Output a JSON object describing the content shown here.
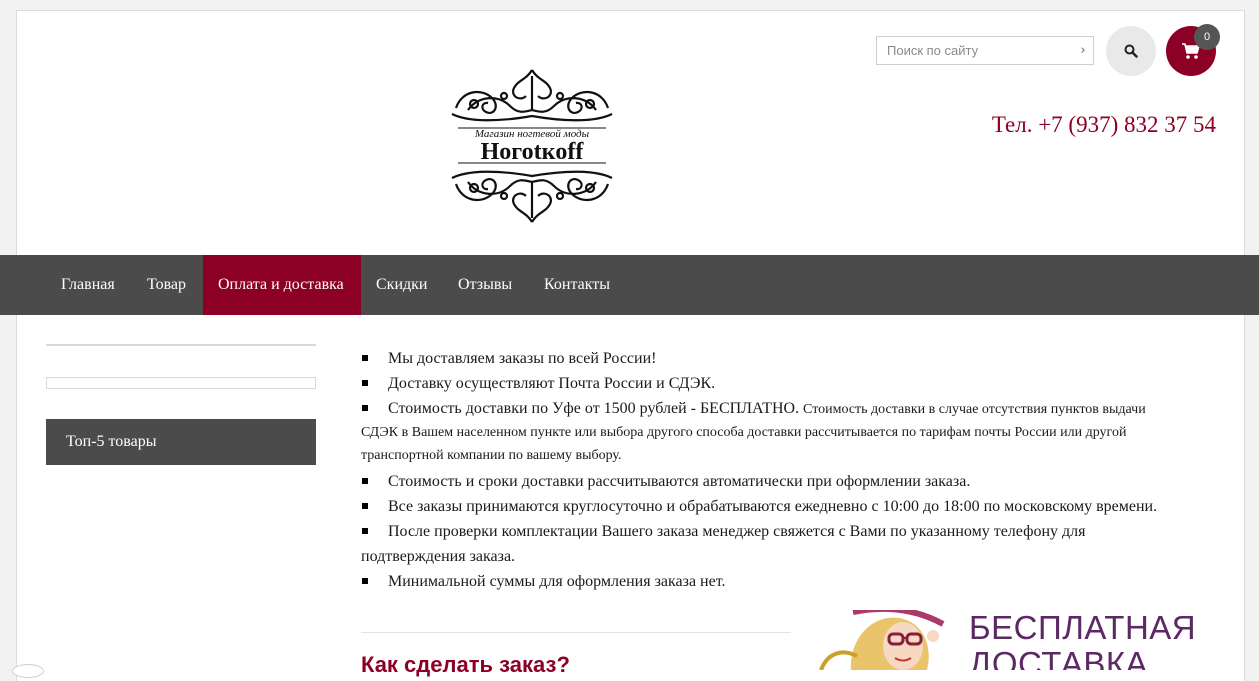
{
  "header": {
    "logo": {
      "tagline": "Магазин ногтевой моды",
      "brand": "Ногоtкoff"
    },
    "search": {
      "placeholder": "Поиск по сайту"
    },
    "cart": {
      "count": "0"
    },
    "phone": "Тел. +7 (937) 832 37 54"
  },
  "nav": {
    "items": [
      {
        "label": "Главная"
      },
      {
        "label": "Товар"
      },
      {
        "label": "Оплата и доставка",
        "active": true
      },
      {
        "label": "Скидки"
      },
      {
        "label": "Отзывы"
      },
      {
        "label": "Контакты"
      }
    ]
  },
  "sidebar": {
    "widget_title": "Топ-5 товары"
  },
  "content": {
    "bullets": [
      "Мы доставляем заказы по всей России!",
      "Доставку осуществляют Почта России и СДЭК.",
      "Стоимость доставки по Уфе от 1500 рублей - БЕСПЛАТНО.",
      "Стоимость и сроки доставки рассчитываются автоматически при оформлении заказа.",
      "Все заказы принимаются круглосуточно и обрабатываются ежедневно с 10:00 до 18:00 по московскому времени.",
      "После проверки комплектации Вашего заказа менеджер свяжется с Вами по указанному телефону для подтверждения заказа.",
      "Минимальной суммы для оформления заказа нет."
    ],
    "small_note": "Стоимость доставки в случае отсутствия пунктов выдачи СДЭК в Вашем населенном пункте или выбора другого способа доставки рассчитывается по тарифам почты России или другой транспортной компании по вашему выбору.",
    "howto_heading": "Как сделать заказ?",
    "banner": {
      "line1": "БЕСПЛАТНАЯ",
      "line2": "ДОСТАВКА"
    }
  },
  "colors": {
    "accent": "#8b0024",
    "nav_bg": "#4b4b4b",
    "banner_text": "#5b2a63"
  }
}
